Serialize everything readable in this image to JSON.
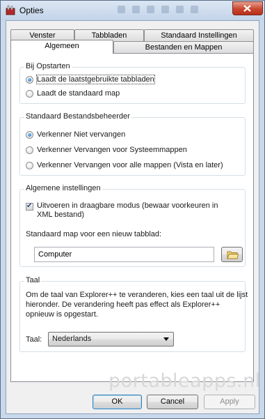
{
  "window": {
    "title": "Opties"
  },
  "tabs": {
    "row_back": [
      "Venster",
      "Tabbladen",
      "Standaard Instellingen"
    ],
    "row_front": [
      "Algemeen",
      "Bestanden en Mappen"
    ],
    "active": "Algemeen"
  },
  "groups": {
    "startup": {
      "legend": "Bij Opstarten",
      "options": [
        {
          "label": "Laadt de laatstgebruikte tabbladen",
          "selected": true
        },
        {
          "label": "Laadt de standaard map",
          "selected": false
        }
      ]
    },
    "file_manager": {
      "legend": "Standaard Bestandsbeheerder",
      "options": [
        {
          "label": "Verkenner Niet vervangen",
          "selected": true
        },
        {
          "label": "Verkenner Vervangen voor Systeemmappen",
          "selected": false
        },
        {
          "label": "Verkenner Vervangen voor alle mappen (Vista en later)",
          "selected": false
        }
      ]
    },
    "general": {
      "legend": "Algemene instellingen",
      "portable_checkbox": {
        "label": "Uitvoeren in draagbare modus (bewaar voorkeuren in XML bestand)",
        "checked": true
      },
      "default_folder_label": "Standaard map voor een nieuw tabblad:",
      "default_folder_value": "Computer"
    },
    "language": {
      "legend": "Taal",
      "description": "Om de taal van Explorer++ te veranderen, kies een taal uit de lijst hieronder. De verandering heeft pas effect als Explorer++ opnieuw is opgestart.",
      "label": "Taal:",
      "selected": "Nederlands"
    }
  },
  "buttons": {
    "ok": "OK",
    "cancel": "Cancel",
    "apply": "Apply"
  },
  "watermark": "portableapps.nl",
  "colors": {
    "titlebar": "#c9d8ea",
    "close_button": "#c9472f",
    "panel_border": "#898c95",
    "default_button_border": "#3c7fb1"
  }
}
